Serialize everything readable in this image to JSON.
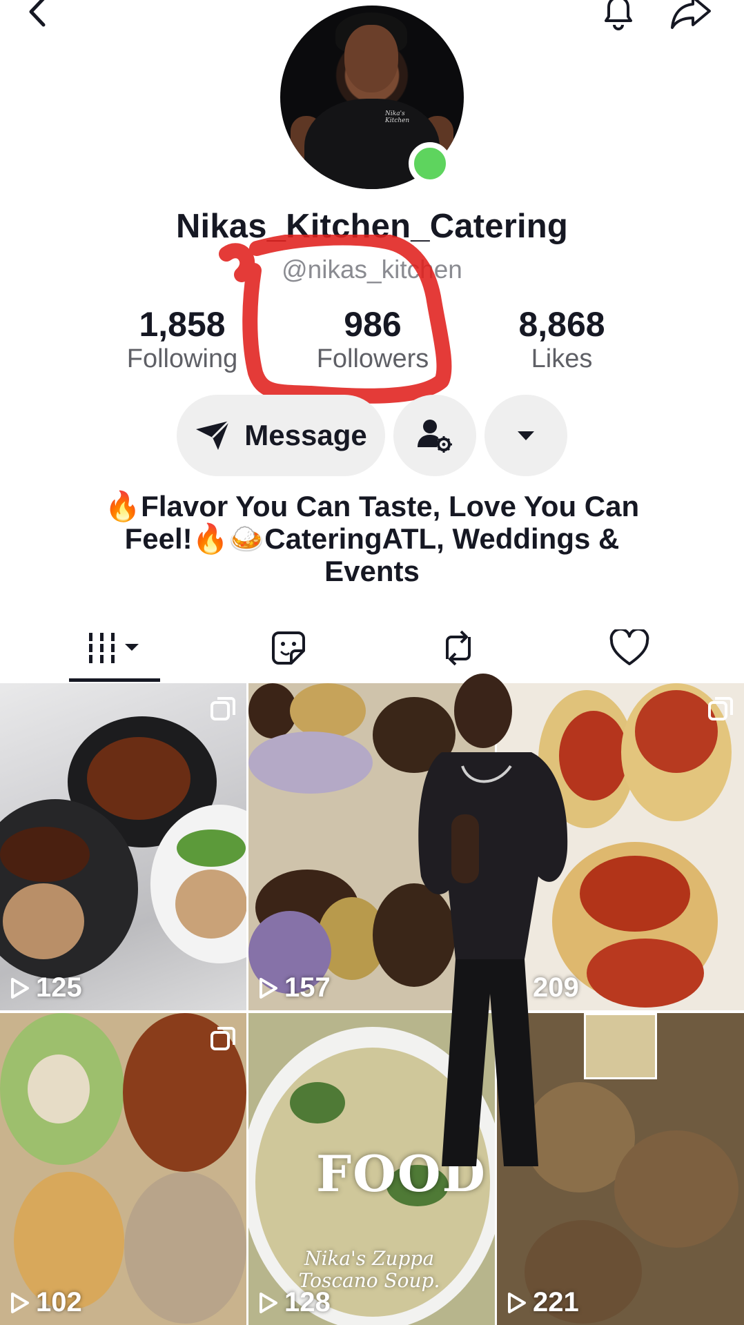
{
  "profile": {
    "display_name": "Nikas_Kitchen_Catering",
    "handle": "@nikas_kitchen",
    "stats": {
      "following_count": "1,858",
      "following_label": "Following",
      "followers_count": "986",
      "followers_label": "Followers",
      "likes_count": "8,868",
      "likes_label": "Likes"
    },
    "bio_line1": "🔥Flavor You Can Taste, Love You Can",
    "bio_line2": "Feel!🔥🍛CateringATL, Weddings  &",
    "bio_line3": "Events",
    "avatar_shirt_text": "Nika's Kitchen"
  },
  "actions": {
    "message_label": "Message"
  },
  "tabs": [
    {
      "name": "videos",
      "icon": "grid-icon",
      "selected": true
    },
    {
      "name": "stickers",
      "icon": "sticker-icon",
      "selected": false
    },
    {
      "name": "reposts",
      "icon": "repost-icon",
      "selected": false
    },
    {
      "name": "liked",
      "icon": "heart-icon",
      "selected": false
    }
  ],
  "videos": [
    {
      "views": "125",
      "multi": true
    },
    {
      "views": "157",
      "multi": true
    },
    {
      "views": "209",
      "multi": true
    },
    {
      "views": "102",
      "multi": true
    },
    {
      "views": "128",
      "multi": false,
      "overlay_text": "FOOD",
      "caption": "Nika's Zuppa Toscano Soup."
    },
    {
      "views": "221",
      "multi": false
    }
  ],
  "colors": {
    "online": "#5ed45e",
    "button_bg": "#efefef",
    "annotation": "#e0201c",
    "text_primary": "#161823",
    "text_secondary": "#8a8b91"
  }
}
